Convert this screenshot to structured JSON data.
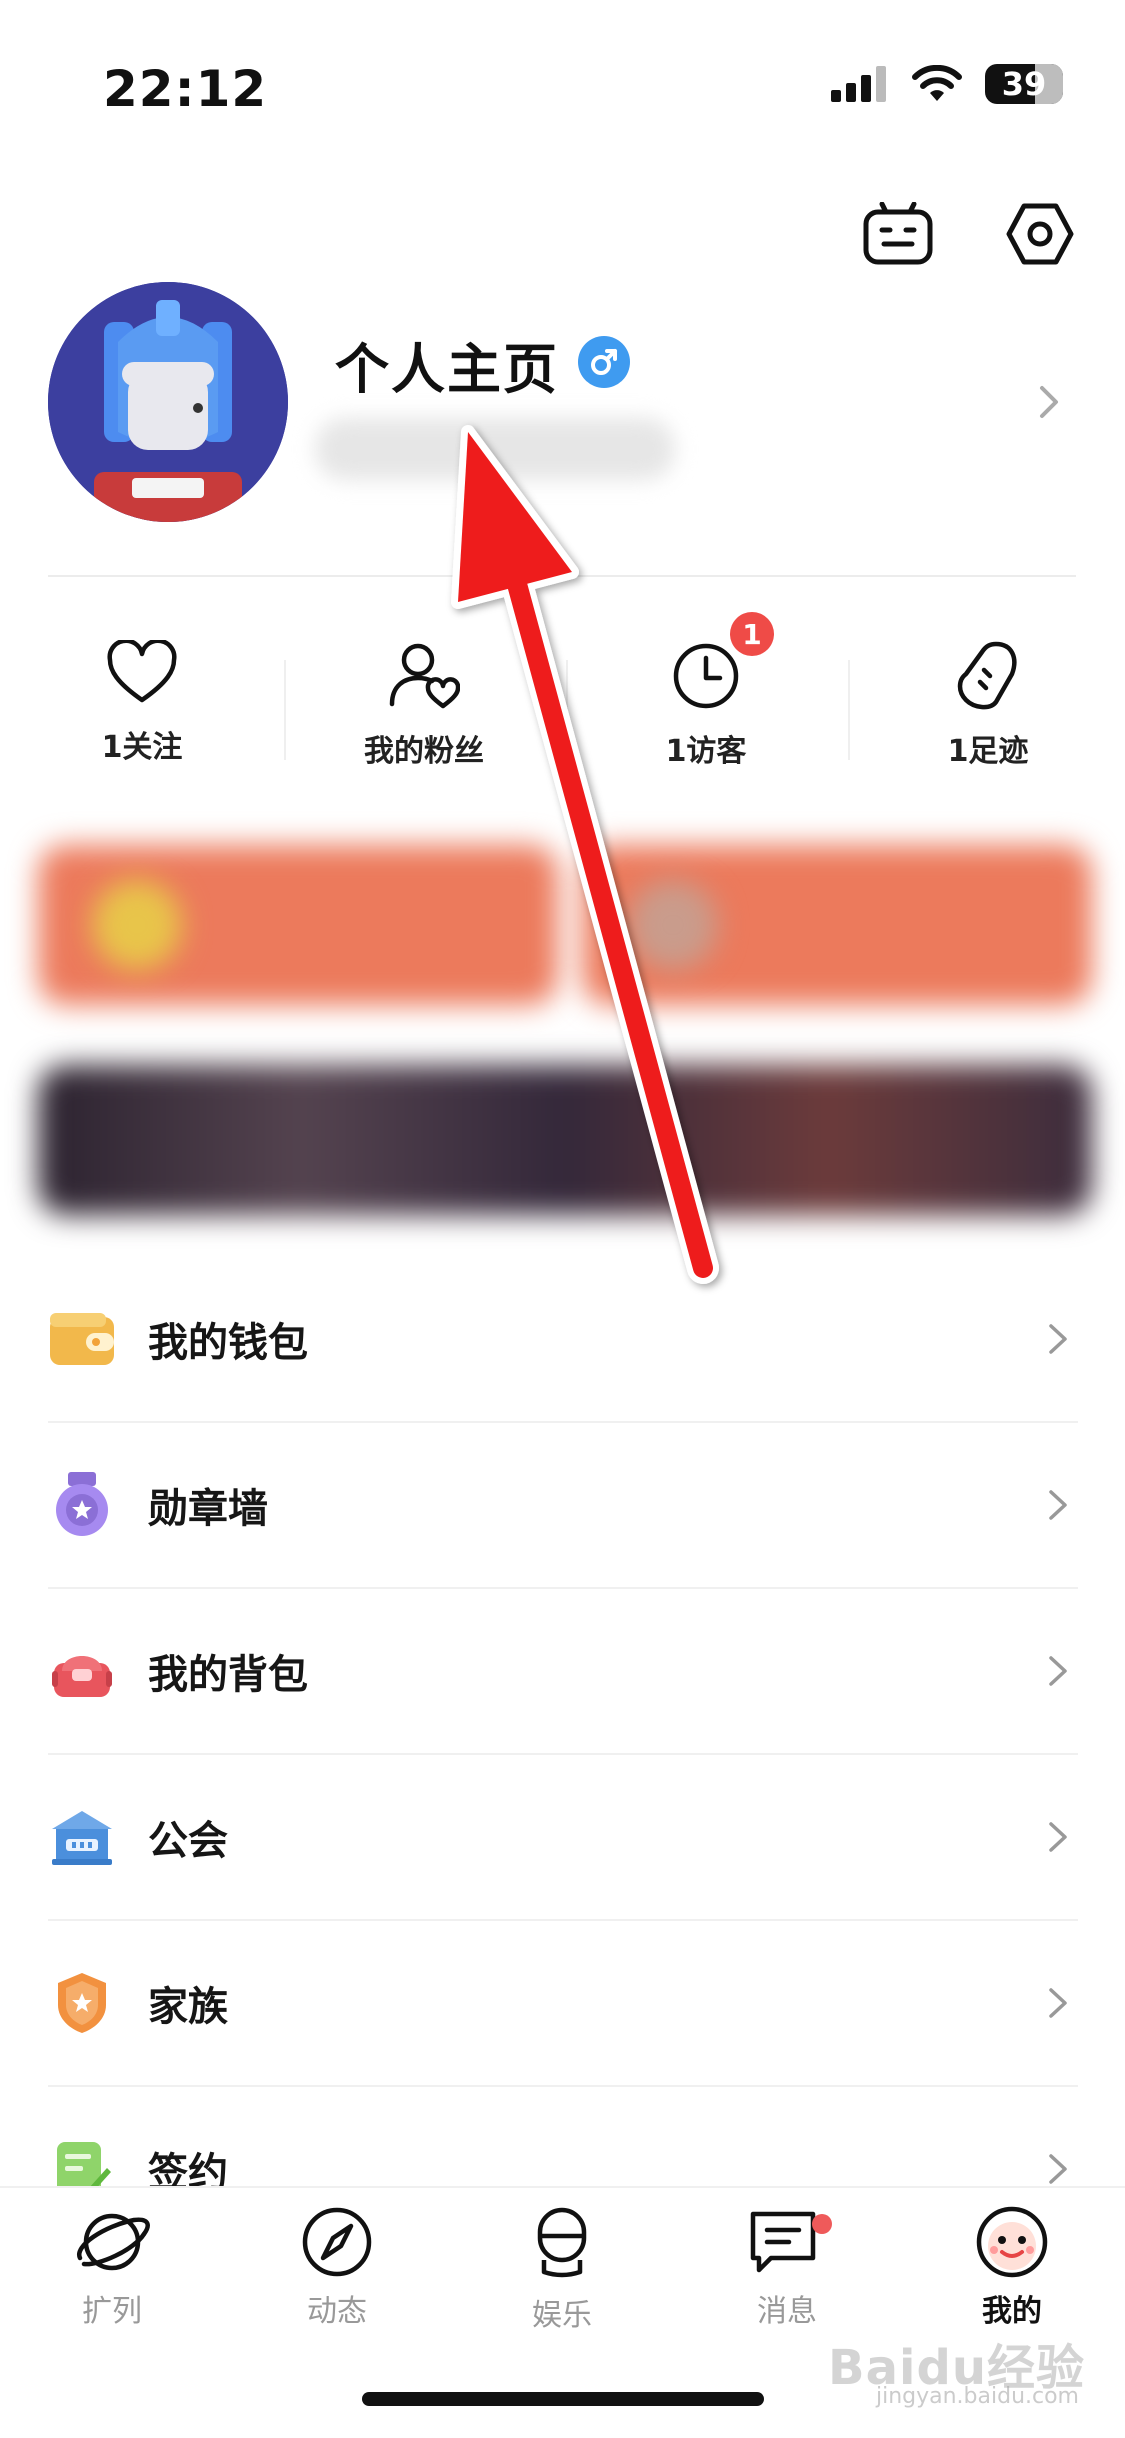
{
  "status_bar": {
    "time": "22:12",
    "battery": "39"
  },
  "profile": {
    "title": "个人主页"
  },
  "stats": [
    {
      "label": "1关注"
    },
    {
      "label": "我的粉丝"
    },
    {
      "label": "1访客",
      "badge": "1"
    },
    {
      "label": "1足迹"
    }
  ],
  "menu": [
    {
      "label": "我的钱包",
      "icon": "wallet-icon"
    },
    {
      "label": "勋章墙",
      "icon": "medal-icon"
    },
    {
      "label": "我的背包",
      "icon": "backpack-icon"
    },
    {
      "label": "公会",
      "icon": "guild-icon"
    },
    {
      "label": "家族",
      "icon": "family-shield-icon"
    },
    {
      "label": "签约",
      "icon": "contract-icon"
    }
  ],
  "tabs": [
    {
      "label": "扩列",
      "icon": "planet-icon"
    },
    {
      "label": "动态",
      "icon": "compass-icon"
    },
    {
      "label": "娱乐",
      "icon": "microphone-icon"
    },
    {
      "label": "消息",
      "icon": "message-icon"
    },
    {
      "label": "我的",
      "icon": "profile-face-icon",
      "active": true
    }
  ],
  "watermark": {
    "brand": "Baidu经验",
    "url": "jingyan.baidu.com"
  },
  "colors": {
    "accent_red": "#ef3b36",
    "badge_red": "#ef4b47",
    "gender_blue": "#3f9bf0",
    "banner_orange": "#ec7a5c"
  }
}
